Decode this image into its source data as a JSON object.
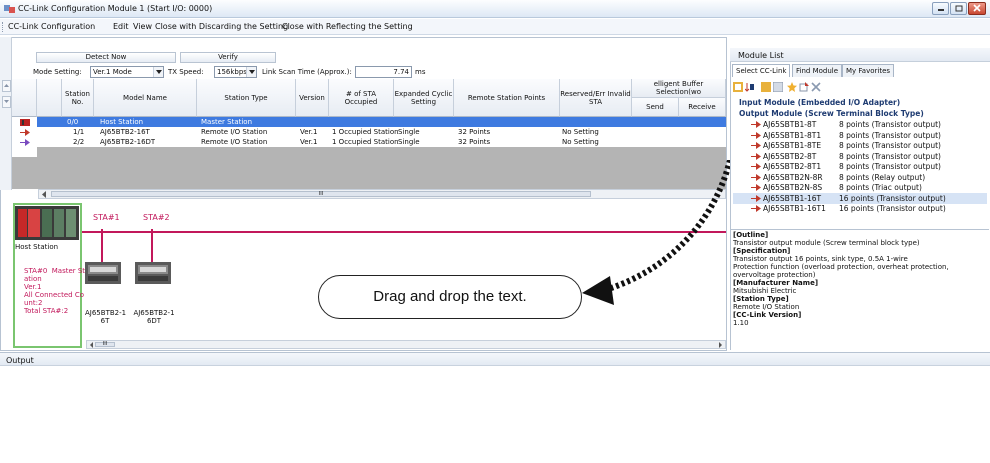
{
  "window": {
    "title": "CC-Link Configuration Module 1 (Start I/O: 0000)"
  },
  "menu": [
    "CC-Link Configuration",
    "Edit",
    "View",
    "Close with Discarding the Setting",
    "Close with Reflecting the Setting"
  ],
  "toolbar": {
    "detect_label": "Detect Now",
    "verify_label": "Verify",
    "mode_label": "Mode Setting:",
    "mode_value": "Ver.1 Mode",
    "tx_label": "TX Speed:",
    "tx_value": "156kbps",
    "scan_label": "Link Scan Time (Approx.):",
    "scan_value": "7.74",
    "scan_unit": "ms"
  },
  "table": {
    "headers": [
      "Station No.",
      "Model Name",
      "Station Type",
      "Version",
      "# of STA Occupied",
      "Expanded Cyclic Setting",
      "Remote Station Points",
      "Reserved/Err Invalid STA",
      "elligent Buffer Selection(wo",
      "Send",
      "Receive"
    ],
    "rows": [
      {
        "station": "0/0",
        "model": "Host Station",
        "type": "Master Station",
        "version": "",
        "occupied": "",
        "cyclic": "",
        "points": "",
        "reserved": ""
      },
      {
        "station": "1/1",
        "model": "AJ65BTB2-16T",
        "type": "Remote I/O Station",
        "version": "Ver.1",
        "occupied": "1 Occupied Station",
        "cyclic": "Single",
        "points": "32 Points",
        "reserved": "No Setting"
      },
      {
        "station": "2/2",
        "model": "AJ65BTB2-16DT",
        "type": "Remote I/O Station",
        "version": "Ver.1",
        "occupied": "1 Occupied Station",
        "cyclic": "Single",
        "points": "32 Points",
        "reserved": "No Setting"
      }
    ],
    "hscroll_mark": "III"
  },
  "diagram": {
    "sta1": "STA#1",
    "sta2": "STA#2",
    "host_label": "Host Station",
    "host_info": "STA#0  Master St\nation\nVer.1\nAll Connected Co\nunt:2\nTotal STA#:2",
    "dev1_label": "AJ65BTB2-1\n6T",
    "dev2_label": "AJ65BTB2-1\n6DT",
    "hscroll_mark": "III"
  },
  "callout": "Drag and drop the text.",
  "output": {
    "title": "Output"
  },
  "module_list": {
    "title": "Module List",
    "tabs": [
      "Select CC-Link",
      "Find Module",
      "My Favorites"
    ],
    "categories": [
      "Input Module (Embedded I/O Adapter)",
      "Output Module (Screw Terminal Block Type)"
    ],
    "items": [
      {
        "name": "AJ65SBTB1-8T",
        "desc": "8 points (Transistor output)"
      },
      {
        "name": "AJ65SBTB1-8T1",
        "desc": "8 points (Transistor output)"
      },
      {
        "name": "AJ65SBTB1-8TE",
        "desc": "8 points (Transistor output)"
      },
      {
        "name": "AJ65SBTB2-8T",
        "desc": "8 points (Transistor output)"
      },
      {
        "name": "AJ65SBTB2-8T1",
        "desc": "8 points (Transistor output)"
      },
      {
        "name": "AJ65SBTB2N-8R",
        "desc": "8 points (Relay output)"
      },
      {
        "name": "AJ65SBTB2N-8S",
        "desc": "8 points (Triac output)"
      },
      {
        "name": "AJ65SBTB1-16T",
        "desc": "16 points (Transistor output)"
      },
      {
        "name": "AJ65SBTB1-16T1",
        "desc": "16 points (Transistor output)"
      }
    ],
    "info": [
      {
        "h": "[Outline]",
        "t": "Transistor output module (Screw terminal block type)"
      },
      {
        "h": "[Specification]",
        "t": "Transistor output 16 points, sink type, 0.5A 1-wire\nProtection function (overload protection, overheat protection,\novervoltage protection)"
      },
      {
        "h": "[Manufacturer Name]",
        "t": "Mitsubishi Electric"
      },
      {
        "h": "[Station Type]",
        "t": "Remote I/O Station"
      },
      {
        "h": "[CC-Link Version]",
        "t": "1.10"
      }
    ]
  },
  "colors": {
    "selection": "#3e7ae0",
    "line": "#c2185b",
    "host_border": "#7ac56f",
    "sta_label": "#c2185b"
  }
}
